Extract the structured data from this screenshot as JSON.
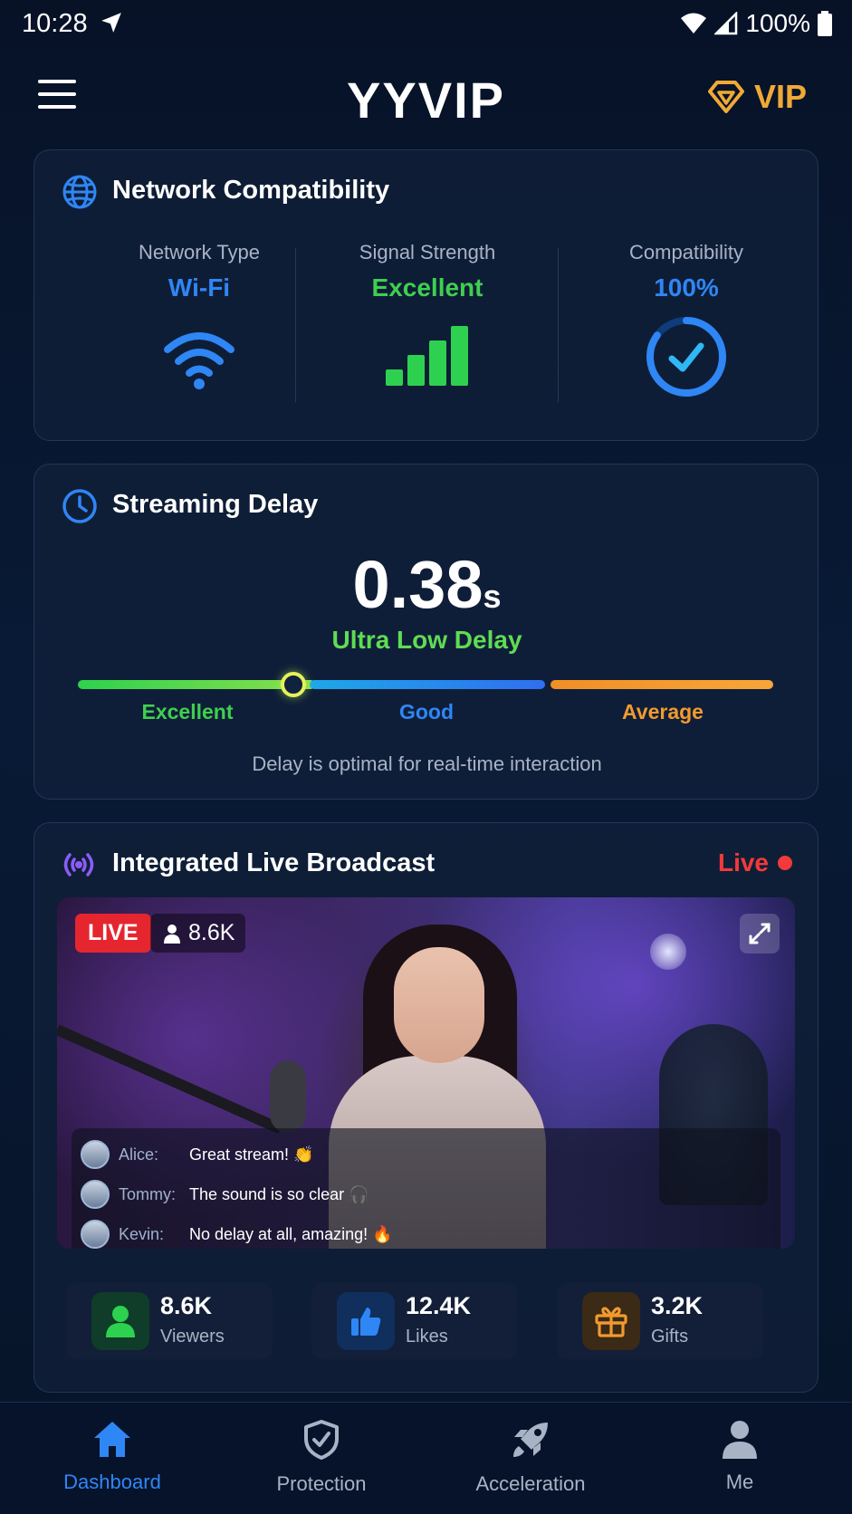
{
  "status_bar": {
    "time": "10:28",
    "battery": "100%"
  },
  "header": {
    "title": "YYVIP",
    "vip_label": "VIP"
  },
  "network_card": {
    "title": "Network Compatibility",
    "columns": [
      {
        "label": "Network Type",
        "value": "Wi-Fi"
      },
      {
        "label": "Signal Strength",
        "value": "Excellent"
      },
      {
        "label": "Compatibility",
        "value": "100%"
      }
    ],
    "signal_bars_filled": 4,
    "compatibility_ring_fraction": 0.85
  },
  "delay_card": {
    "title": "Streaming Delay",
    "value": "0.38",
    "unit": "s",
    "status": "Ultra Low Delay",
    "scale_labels": [
      "Excellent",
      "Good",
      "Average"
    ],
    "indicator_fraction": 0.31,
    "note": "Delay is optimal for real-time interaction"
  },
  "live_card": {
    "title": "Integrated Live Broadcast",
    "live_label": "Live",
    "badge": "LIVE",
    "viewers_badge": "8.6K",
    "chat": [
      {
        "name": "Alice:",
        "message": "Great stream! 👏"
      },
      {
        "name": "Tommy:",
        "message": "The sound is so clear 🎧"
      },
      {
        "name": "Kevin:",
        "message": "No delay at all, amazing! 🔥"
      }
    ],
    "stats": [
      {
        "value": "8.6K",
        "label": "Viewers"
      },
      {
        "value": "12.4K",
        "label": "Likes"
      },
      {
        "value": "3.2K",
        "label": "Gifts"
      }
    ]
  },
  "bottom_nav": [
    {
      "label": "Dashboard",
      "active": true
    },
    {
      "label": "Protection"
    },
    {
      "label": "Acceleration"
    },
    {
      "label": "Me"
    }
  ],
  "colors": {
    "accent_blue": "#2f86f5",
    "success_green": "#3fcf4f",
    "warning_orange": "#f29a2e",
    "vip_gold": "#f0a935",
    "live_red": "#e5262f"
  }
}
